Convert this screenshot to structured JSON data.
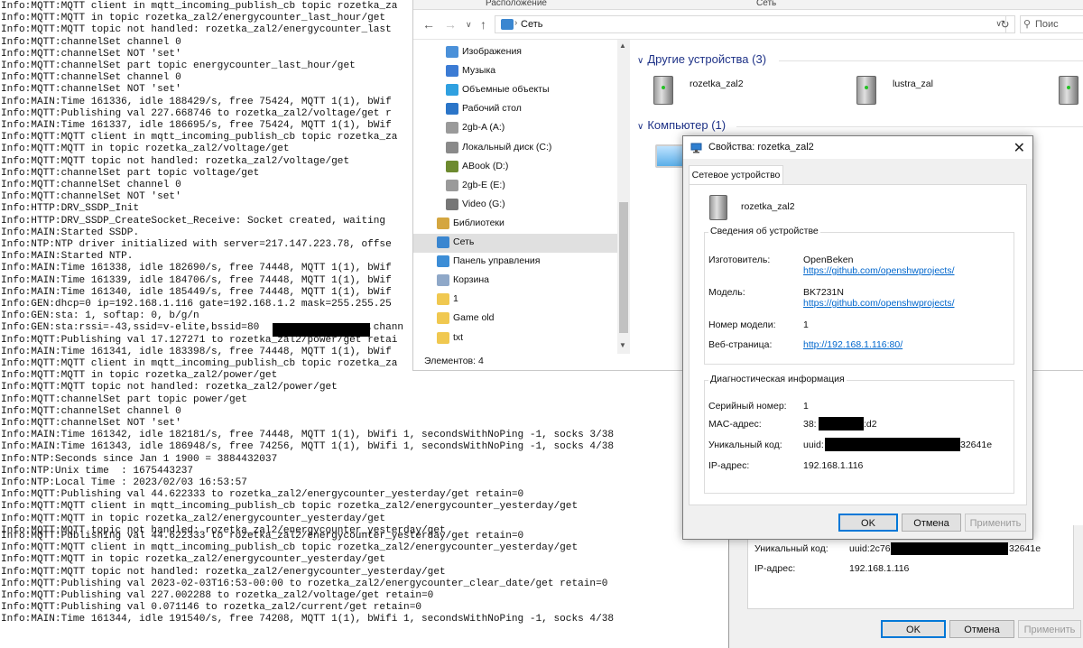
{
  "console": {
    "lines": [
      "Info:MQTT:MQTT client in mqtt_incoming_publish_cb topic rozetka_za",
      "Info:MQTT:MQTT in topic rozetka_zal2/energycounter_last_hour/get",
      "Info:MQTT:MQTT topic not handled: rozetka_zal2/energycounter_last",
      "Info:MQTT:channelSet channel 0",
      "Info:MQTT:channelSet NOT 'set'",
      "Info:MQTT:channelSet part topic energycounter_last_hour/get",
      "Info:MQTT:channelSet channel 0",
      "Info:MQTT:channelSet NOT 'set'",
      "Info:MAIN:Time 161336, idle 188429/s, free 75424, MQTT 1(1), bWif",
      "Info:MQTT:Publishing val 227.668746 to rozetka_zal2/voltage/get r",
      "Info:MAIN:Time 161337, idle 186695/s, free 75424, MQTT 1(1), bWif",
      "Info:MQTT:MQTT client in mqtt_incoming_publish_cb topic rozetka_za",
      "Info:MQTT:MQTT in topic rozetka_zal2/voltage/get",
      "Info:MQTT:MQTT topic not handled: rozetka_zal2/voltage/get",
      "Info:MQTT:channelSet part topic voltage/get",
      "Info:MQTT:channelSet channel 0",
      "Info:MQTT:channelSet NOT 'set'",
      "Info:HTTP:DRV_SSDP_Init",
      "Info:HTTP:DRV_SSDP_CreateSocket_Receive: Socket created, waiting",
      "Info:MAIN:Started SSDP.",
      "Info:NTP:NTP driver initialized with server=217.147.223.78, offse",
      "Info:MAIN:Started NTP.",
      "Info:MAIN:Time 161338, idle 182690/s, free 74448, MQTT 1(1), bWif",
      "Info:MAIN:Time 161339, idle 184706/s, free 74448, MQTT 1(1), bWif",
      "Info:MAIN:Time 161340, idle 185449/s, free 74448, MQTT 1(1), bWif",
      "Info:GEN:dhcp=0 ip=192.168.1.116 gate=192.168.1.2 mask=255.255.25",
      "Info:GEN:sta: 1, softap: 0, b/g/n",
      "Info:GEN:sta:rssi=-43,ssid=v-elite,bssid=80                  ,chann",
      "Info:MQTT:Publishing val 17.127271 to rozetka_zal2/power/get retai",
      "Info:MAIN:Time 161341, idle 183398/s, free 74448, MQTT 1(1), bWif",
      "Info:MQTT:MQTT client in mqtt_incoming_publish_cb topic rozetka_za",
      "Info:MQTT:MQTT in topic rozetka_zal2/power/get",
      "Info:MQTT:MQTT topic not handled: rozetka_zal2/power/get",
      "Info:MQTT:channelSet part topic power/get",
      "Info:MQTT:channelSet channel 0",
      "Info:MQTT:channelSet NOT 'set'",
      "Info:MAIN:Time 161342, idle 182181/s, free 74448, MQTT 1(1), bWifi 1, secondsWithNoPing -1, socks 3/38",
      "Info:MAIN:Time 161343, idle 186948/s, free 74256, MQTT 1(1), bWifi 1, secondsWithNoPing -1, socks 4/38",
      "Info:NTP:Seconds since Jan 1 1900 = 3884432037",
      "Info:NTP:Unix time  : 1675443237",
      "Info:NTP:Local Time : 2023/02/03 16:53:57",
      "Info:MQTT:Publishing val 44.622333 to rozetka_zal2/energycounter_yesterday/get retain=0",
      "Info:MQTT:MQTT client in mqtt_incoming_publish_cb topic rozetka_zal2/energycounter_yesterday/get",
      "Info:MQTT:MQTT in topic rozetka_zal2/energycounter_yesterday/get",
      "Info:MQTT:MQTT topic not handled: rozetka_zal2/energycounter_yesterday/get",
      "Info:MQTT:Publishing val 44.622333 to rozetka_zal2/energycounter_yesterday/get retain=0",
      "Info:MQTT:MQTT client in mqtt_incoming_publish_cb topic rozetka_zal2/energycounter_yesterday/get",
      "Info:MQTT:MQTT in topic rozetka_zal2/energycounter_yesterday/get",
      "Info:MQTT:MQTT topic not handled: rozetka_zal2/energycounter_yesterday/get",
      "Info:MQTT:Publishing val 2023-02-03T16:53-00:00 to rozetka_zal2/energycounter_clear_date/get retain=0",
      "Info:MQTT:Publishing val 227.002288 to rozetka_zal2/voltage/get retain=0",
      "Info:MQTT:Publishing val 0.071146 to rozetka_zal2/current/get retain=0",
      "Info:MAIN:Time 161344, idle 191540/s, free 74208, MQTT 1(1), bWifi 1, secondsWithNoPing -1, socks 4/38"
    ]
  },
  "bg_dialog": {
    "uuid_label": "Уникальный код:",
    "uuid_value_start": "uuid:2c76",
    "uuid_value_end": "32641e",
    "ip_label": "IP-адрес:",
    "ip_value": "192.168.1.116",
    "ok": "OK",
    "cancel": "Отмена",
    "apply": "Применить"
  },
  "explorer": {
    "header_location": "Расположение",
    "header_network": "Сеть",
    "address": "Сеть",
    "search_placeholder": "Поис",
    "nav_items": [
      {
        "label": "Изображения",
        "icon": "pictures-icon",
        "color": "#4a90d9"
      },
      {
        "label": "Музыка",
        "icon": "music-icon",
        "color": "#3b7bd4"
      },
      {
        "label": "Объемные объекты",
        "icon": "3d-objects-icon",
        "color": "#2fa0e0"
      },
      {
        "label": "Рабочий стол",
        "icon": "desktop-icon",
        "color": "#2b75c8"
      },
      {
        "label": "2gb-A (A:)",
        "icon": "drive-icon",
        "color": "#9a9a9a"
      },
      {
        "label": "Локальный диск (C:)",
        "icon": "disk-icon",
        "color": "#8a8a8a"
      },
      {
        "label": "ABook (D:)",
        "icon": "book-drive-icon",
        "color": "#6d8a2f"
      },
      {
        "label": "2gb-E (E:)",
        "icon": "drive-icon",
        "color": "#9a9a9a"
      },
      {
        "label": "Video (G:)",
        "icon": "dvd-icon",
        "color": "#777777"
      },
      {
        "label": "Библиотеки",
        "icon": "libraries-icon",
        "color": "#d4a640"
      },
      {
        "label": "Сеть",
        "icon": "network-icon",
        "color": "#3a86d0"
      },
      {
        "label": "Панель управления",
        "icon": "control-panel-icon",
        "color": "#3c8dd6"
      },
      {
        "label": "Корзина",
        "icon": "recycle-bin-icon",
        "color": "#8fa8c8"
      },
      {
        "label": "1",
        "icon": "folder-icon",
        "color": "#f0c850"
      },
      {
        "label": "Game old",
        "icon": "folder-icon",
        "color": "#f0c850"
      },
      {
        "label": "txt",
        "icon": "folder-icon",
        "color": "#f0c850"
      }
    ],
    "selected_index": 10,
    "status": "Элементов: 4",
    "groups": {
      "other_devices": "Другие устройства (3)",
      "computer": "Компьютер (1)"
    },
    "devices": [
      "rozetka_zal2",
      "lustra_zal"
    ]
  },
  "dialog": {
    "title": "Свойства: rozetka_zal2",
    "tab": "Сетевое устройство",
    "device_name": "rozetka_zal2",
    "info_legend": "Сведения об устройстве",
    "manufacturer_label": "Изготовитель:",
    "manufacturer_value": "OpenBeken",
    "manufacturer_link": "https://github.com/openshwprojects/",
    "model_label": "Модель:",
    "model_value": "BK7231N",
    "model_link": "https://github.com/openshwprojects/",
    "model_number_label": "Номер модели:",
    "model_number_value": "1",
    "webpage_label": "Веб-страница:",
    "webpage_link": "http://192.168.1.116:80/",
    "diag_legend": "Диагностическая информация",
    "serial_label": "Серийный номер:",
    "serial_value": "1",
    "mac_label": "MAC-адрес:",
    "mac_value_start": "38:",
    "mac_value_end": ":d2",
    "uuid_label": "Уникальный код:",
    "uuid_value_start": "uuid:",
    "uuid_value_end": "32641e",
    "ip_label": "IP-адрес:",
    "ip_value": "192.168.1.116",
    "ok": "OK",
    "cancel": "Отмена",
    "apply": "Применить"
  }
}
